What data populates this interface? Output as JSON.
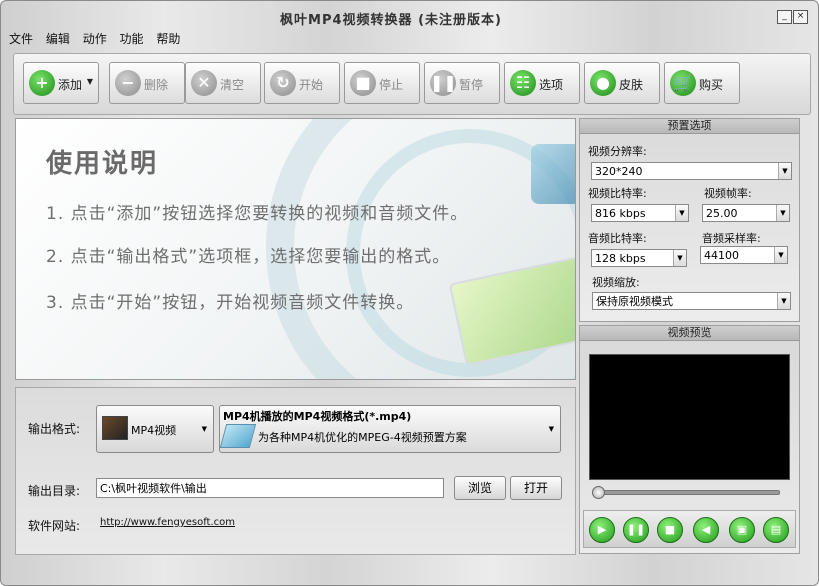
{
  "window": {
    "title": "枫叶MP4视频转换器 (未注册版本)",
    "min_btn": "_",
    "close_btn": "×"
  },
  "menu": [
    "文件",
    "编辑",
    "动作",
    "功能",
    "帮助"
  ],
  "toolbar": {
    "add": "添加",
    "delete": "删除",
    "clear": "清空",
    "start": "开始",
    "stop": "停止",
    "pause": "暂停",
    "options": "选项",
    "skin": "皮肤",
    "buy": "购买"
  },
  "instructions": {
    "title": "使用说明",
    "steps": [
      "1. 点击“添加”按钮选择您要转换的视频和音频文件。",
      "2. 点击“输出格式”选项框，选择您要输出的格式。",
      "3. 点击“开始”按钮，开始视频音频文件转换。"
    ]
  },
  "presets": {
    "header": "预置选项",
    "resolution_label": "视频分辨率:",
    "resolution_value": "320*240",
    "vbitrate_label": "视频比特率:",
    "vbitrate_value": "816 kbps",
    "framerate_label": "视频帧率:",
    "framerate_value": "25.00",
    "abitrate_label": "音频比特率:",
    "abitrate_value": "128 kbps",
    "samplerate_label": "音频采样率:",
    "samplerate_value": "44100",
    "scale_label": "视频缩放:",
    "scale_value": "保持原视频模式"
  },
  "preview": {
    "header": "视频预览",
    "progress": 0
  },
  "output": {
    "format_label": "输出格式:",
    "format_button": "MP4视频",
    "format_title": "MP4机播放的MP4视频格式(*.mp4)",
    "format_desc": "为各种MP4机优化的MPEG-4视频预置方案",
    "dir_label": "输出目录:",
    "dir_value": "C:\\枫叶视频软件\\输出",
    "browse": "浏览",
    "open": "打开",
    "site_label": "软件网站:",
    "site_url": "http://www.fengyesoft.com"
  }
}
